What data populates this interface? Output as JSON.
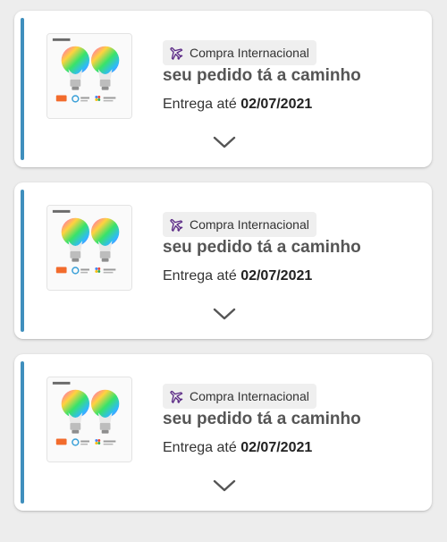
{
  "accent_color": "#3f8fbd",
  "orders": [
    {
      "product_image": "rgb-smart-bulbs-photo",
      "tag_icon": "airplane-icon",
      "tag_label": "Compra Internacional",
      "status": "seu pedido tá a caminho",
      "delivery_prefix": "Entrega até",
      "delivery_date": "02/07/2021",
      "expand_icon": "chevron-down-icon"
    },
    {
      "product_image": "rgb-smart-bulbs-photo",
      "tag_icon": "airplane-icon",
      "tag_label": "Compra Internacional",
      "status": "seu pedido tá a caminho",
      "delivery_prefix": "Entrega até",
      "delivery_date": "02/07/2021",
      "expand_icon": "chevron-down-icon"
    },
    {
      "product_image": "rgb-smart-bulbs-photo",
      "tag_icon": "airplane-icon",
      "tag_label": "Compra Internacional",
      "status": "seu pedido tá a caminho",
      "delivery_prefix": "Entrega até",
      "delivery_date": "02/07/2021",
      "expand_icon": "chevron-down-icon"
    }
  ]
}
